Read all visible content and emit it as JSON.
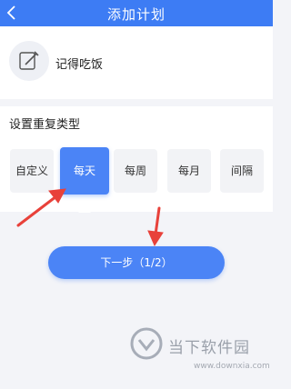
{
  "header": {
    "title": "添加计划",
    "back_icon": "chevron-left-icon"
  },
  "task": {
    "name": "记得吃饭",
    "icon": "pencil-edit-icon"
  },
  "repeat": {
    "label": "设置重复类型",
    "options": [
      "自定义",
      "每天",
      "每周",
      "每月",
      "间隔"
    ],
    "selected": "每天"
  },
  "next_button": {
    "label": "下一步（1/2）"
  },
  "annotation_color": "#e8413a",
  "accent_color": "#4b84f6",
  "watermark": {
    "name": "当下软件园",
    "url": "www.downxia.com",
    "logo_icon": "downxia-logo-icon"
  }
}
